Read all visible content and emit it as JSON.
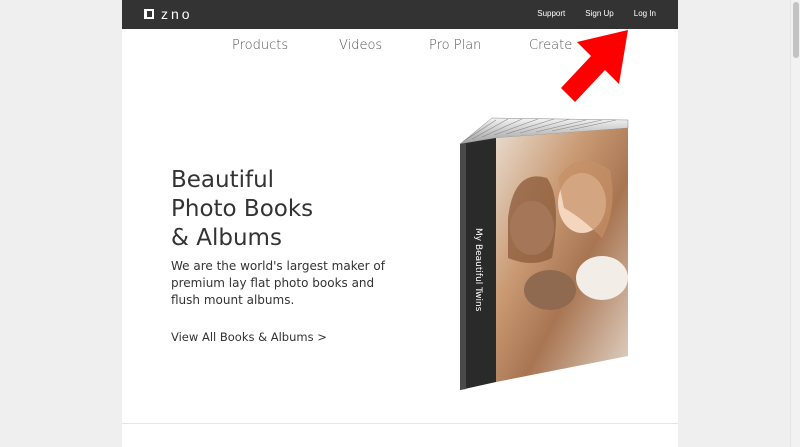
{
  "brand": {
    "logo_text": "zno"
  },
  "topbar": {
    "links": [
      {
        "label": "Support"
      },
      {
        "label": "Sign Up"
      },
      {
        "label": "Log In"
      }
    ]
  },
  "nav": {
    "items": [
      {
        "label": "Products"
      },
      {
        "label": "Videos"
      },
      {
        "label": "Pro Plan"
      },
      {
        "label": "Create"
      }
    ]
  },
  "hero": {
    "title": "Beautiful\nPhoto Books\n& Albums",
    "description": "We are the world's largest maker of premium lay flat photo books and flush mount albums.",
    "cta": "View All Books & Albums >",
    "book_spine_text": "My Beautiful Twins"
  },
  "colors": {
    "topbar_bg": "#333333",
    "annotation_arrow": "#ff0000"
  }
}
